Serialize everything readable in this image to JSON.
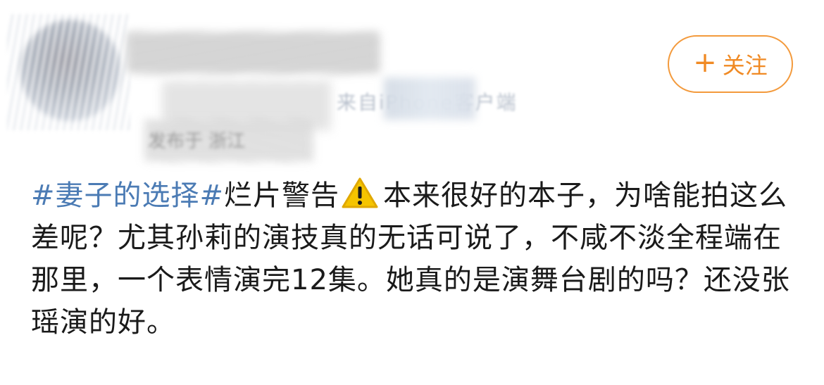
{
  "header": {
    "source_label": "来自iPhone客户端",
    "location_label": "发布于 浙江",
    "follow_button": {
      "plus": "+",
      "label": "关注"
    }
  },
  "post": {
    "hashtag": "#妻子的选择#",
    "text_before_icon": "烂片警告",
    "icon": "warning-icon",
    "text_after_icon": "本来很好的本子，为啥能拍这么差呢？尤其孙莉的演技真的无话可说了，不咸不淡全程端在那里，一个表情演完12集。她真的是演舞台剧的吗？还没张瑶演的好。"
  },
  "colors": {
    "accent_orange": "#f08a24",
    "hashtag_blue": "#4b7bb4",
    "warning_yellow": "#f5c400"
  }
}
